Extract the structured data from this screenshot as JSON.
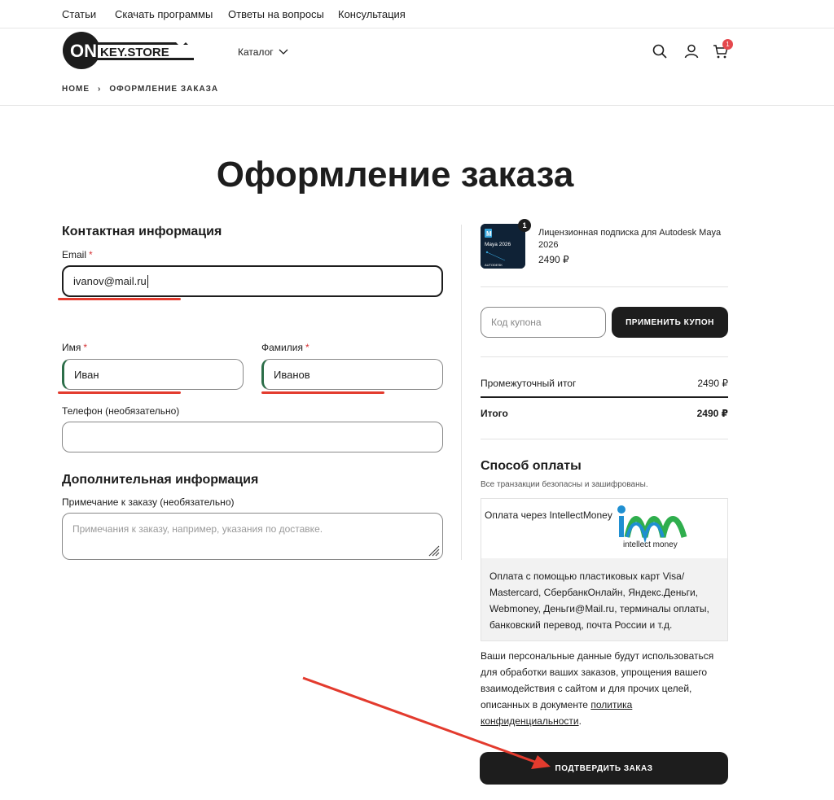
{
  "topnav": {
    "items": [
      "Статьи",
      "Скачать программы",
      "Ответы на вопросы",
      "Консультация"
    ]
  },
  "header": {
    "logo_on": "ON",
    "logo_text": "KEY.STORE",
    "catalog_label": "Каталог",
    "cart_count": "1"
  },
  "breadcrumb": {
    "home": "HOME",
    "separator": "›",
    "current": "ОФОРМЛЕНИЕ ЗАКАЗА"
  },
  "page_title": "Оформление заказа",
  "contact": {
    "title": "Контактная информация",
    "email_label": "Email",
    "email_value": "ivanov@mail.ru",
    "first_name_label": "Имя",
    "first_name_value": "Иван",
    "last_name_label": "Фамилия",
    "last_name_value": "Иванов",
    "phone_label": "Телефон (необязательно)",
    "phone_value": ""
  },
  "additional": {
    "title": "Дополнительная информация",
    "note_label": "Примечание к заказу (необязательно)",
    "note_placeholder": "Примечания к заказу, например, указания по доставке."
  },
  "order": {
    "product_qty": "1",
    "product_thumb_title": "Maya 2026",
    "product_thumb_brand": "AUTODESK",
    "product_name": "Лицензионная подписка для Autodesk Maya 2026",
    "product_price": "2490 ₽",
    "coupon_placeholder": "Код купона",
    "coupon_button": "ПРИМЕНИТЬ КУПОН",
    "subtotal_label": "Промежуточный итог",
    "subtotal_value": "2490 ₽",
    "total_label": "Итого",
    "total_value": "2490 ₽"
  },
  "payment": {
    "title": "Способ оплаты",
    "note": "Все транзакции безопасны и зашифрованы.",
    "method_label": "Оплата через IntellectMoney",
    "logo_text": "intellect money",
    "description": "Оплата с помощью пластиковых карт Visa/ Mastercard, СбербанкОнлайн, Яндекс.Деньги, Webmoney, Деньги@Mail.ru, терминалы оплаты, банковский перевод, почта России и т.д."
  },
  "privacy": {
    "text": "Ваши персональные данные будут использоваться для обработки ваших заказов, упрощения вашего взаимодействия с сайтом и для прочих целей, описанных в документе ",
    "link": "политика конфиденциальности",
    "end": "."
  },
  "confirm_button": "ПОДТВЕРДИТЬ ЗАКАЗ",
  "colors": {
    "accent": "#1d1d1d",
    "annotation_red": "#e33b2e",
    "required": "#d63638",
    "badge": "#e5484d"
  }
}
